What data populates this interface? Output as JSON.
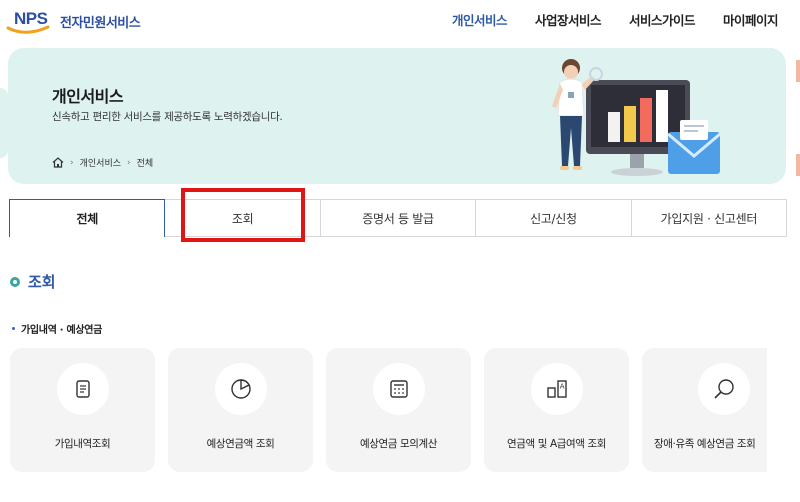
{
  "header": {
    "logo_mark": "NPS",
    "logo_text": "전자민원서비스",
    "nav": [
      {
        "label": "개인서비스",
        "active": true
      },
      {
        "label": "사업장서비스",
        "active": false
      },
      {
        "label": "서비스가이드",
        "active": false
      },
      {
        "label": "마이페이지",
        "active": false
      }
    ]
  },
  "hero": {
    "title": "개인서비스",
    "description": "신속하고 편리한 서비스를 제공하도록 노력하겠습니다.",
    "breadcrumb": [
      "개인서비스",
      "전체"
    ]
  },
  "tabs": [
    {
      "label": "전체",
      "active": true
    },
    {
      "label": "조회",
      "active": false
    },
    {
      "label": "증명서 등 발급",
      "active": false
    },
    {
      "label": "신고/신청",
      "active": false
    },
    {
      "label": "가입지원 · 신고센터",
      "active": false
    }
  ],
  "section": {
    "title": "조회",
    "subsection": "가입내역 · 예상연금",
    "cards": [
      {
        "label": "가입내역조회",
        "icon": "document-icon"
      },
      {
        "label": "예상연금액 조회",
        "icon": "pie-chart-icon"
      },
      {
        "label": "예상연금 모의계산",
        "icon": "calculator-icon"
      },
      {
        "label": "연금액 및 A급여액 조회",
        "icon": "bar-a-icon"
      },
      {
        "label": "장애·유족 예상연금 조회",
        "icon": "magnifier-icon"
      }
    ]
  },
  "colors": {
    "brand_blue": "#2f5aa8",
    "teal": "#3aa79a",
    "hero_bg": "#def2ef",
    "highlight_red": "#e01616"
  }
}
